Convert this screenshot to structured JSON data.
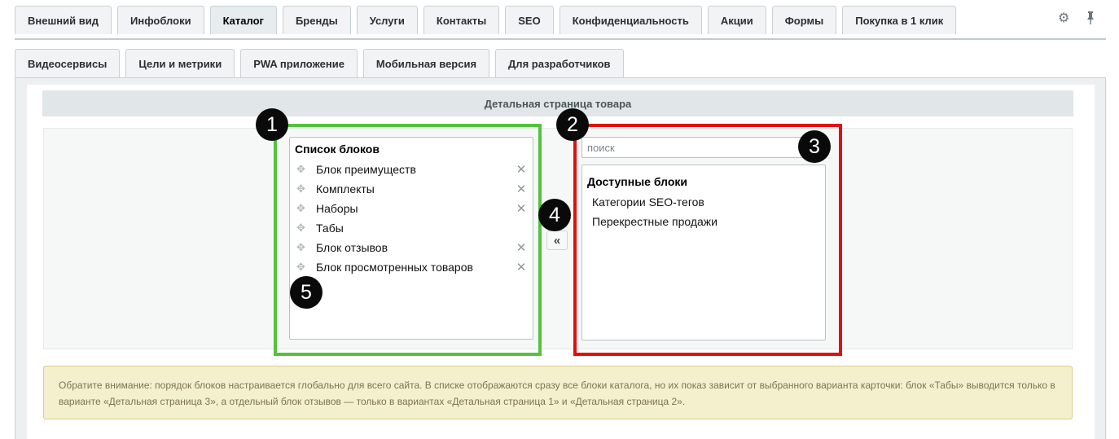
{
  "tabs_row1": [
    "Внешний вид",
    "Инфоблоки",
    "Каталог",
    "Бренды",
    "Услуги",
    "Контакты",
    "SEO",
    "Конфиденциальность",
    "Акции",
    "Формы",
    "Покупка в 1 клик"
  ],
  "active_tab": "Каталог",
  "tabs_row2": [
    "Видеосервисы",
    "Цели и метрики",
    "PWA приложение",
    "Мобильная версия",
    "Для разработчиков"
  ],
  "toolbar": {
    "settings_icon": "gear-icon",
    "pin_icon": "pin-icon"
  },
  "section_title": "Детальная страница товара",
  "block_list": {
    "title": "Список блоков",
    "items": [
      {
        "label": "Блок преимуществ",
        "removable": true
      },
      {
        "label": "Комплекты",
        "removable": true
      },
      {
        "label": "Наборы",
        "removable": true
      },
      {
        "label": "Табы",
        "removable": false
      },
      {
        "label": "Блок отзывов",
        "removable": true
      },
      {
        "label": "Блок просмотренных товаров",
        "removable": true
      }
    ]
  },
  "search": {
    "placeholder": "поиск",
    "value": ""
  },
  "available": {
    "title": "Доступные блоки",
    "items": [
      "Категории SEO-тегов",
      "Перекрестные продажи"
    ]
  },
  "move_button_label": "«",
  "badges": [
    "1",
    "2",
    "3",
    "4",
    "5"
  ],
  "notice": "Обратите внимание: порядок блоков настраивается глобально для всего сайта. В списке отображаются сразу все блоки каталога, но их показ зависит от выбранного варианта карточки: блок «Табы» выводится только в варианте «Детальная страница 3», а отдельный блок отзывов — только в вариантах «Детальная страница 1» и «Детальная страница 2».",
  "colors": {
    "highlight_green": "#54c23d",
    "highlight_red": "#e20f0f",
    "notice_bg": "#f4efcd"
  }
}
